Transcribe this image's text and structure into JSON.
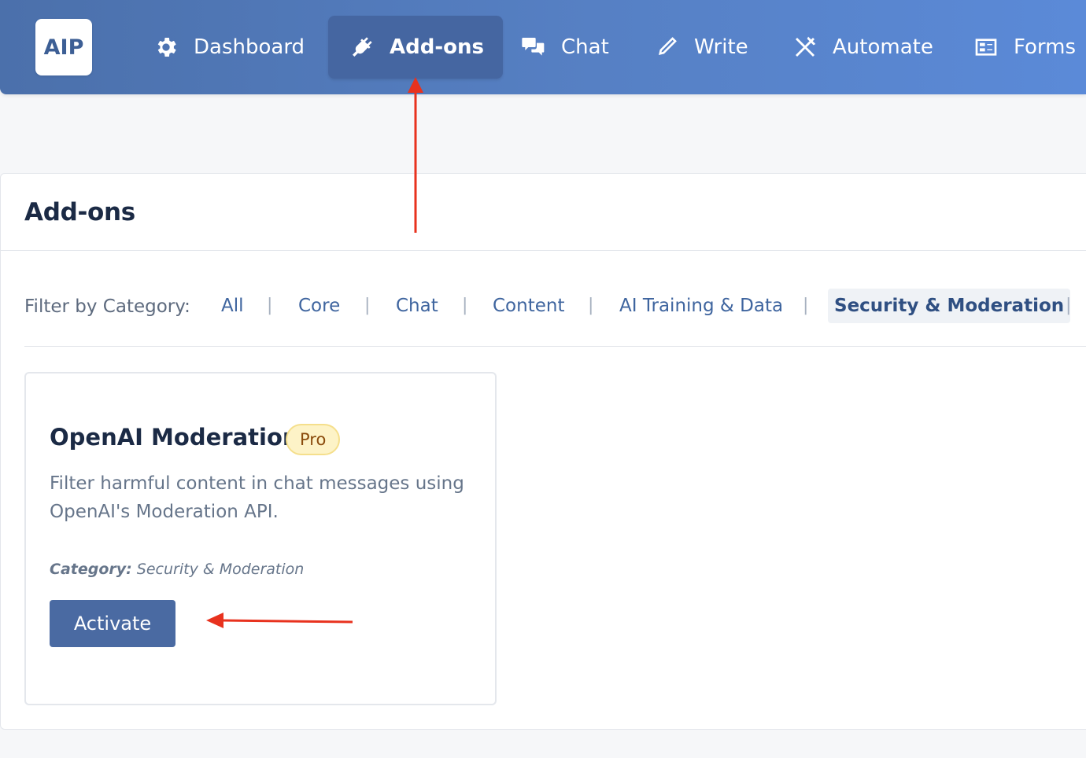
{
  "brand": {
    "logo_text": "AIP"
  },
  "nav": {
    "items": [
      {
        "label": "Dashboard",
        "icon": "gear-icon"
      },
      {
        "label": "Add-ons",
        "icon": "plug-icon",
        "active": true
      },
      {
        "label": "Chat",
        "icon": "chat-bubbles-icon"
      },
      {
        "label": "Write",
        "icon": "pencil-icon"
      },
      {
        "label": "Automate",
        "icon": "tools-icon"
      },
      {
        "label": "Forms",
        "icon": "form-icon"
      }
    ]
  },
  "page": {
    "title": "Add-ons"
  },
  "filter": {
    "label": "Filter by Category:",
    "categories": [
      "All",
      "Core",
      "Chat",
      "Content",
      "AI Training & Data",
      "Security & Moderation"
    ],
    "active": "Security & Moderation",
    "separator": "|"
  },
  "card": {
    "title": "OpenAI Moderation",
    "badge": "Pro",
    "description": "Filter harmful content in chat messages using OpenAI's Moderation API.",
    "category_label": "Category:",
    "category_value": "Security & Moderation",
    "button_label": "Activate"
  },
  "colors": {
    "nav_gradient_start": "#4b70ab",
    "nav_gradient_end": "#5b8ad8",
    "nav_active_bg": "#4566a1",
    "primary_button": "#4a6aa2",
    "badge_bg": "#fdf3c7",
    "badge_text": "#8a4b0c",
    "annotation_arrow": "#e8321e"
  }
}
